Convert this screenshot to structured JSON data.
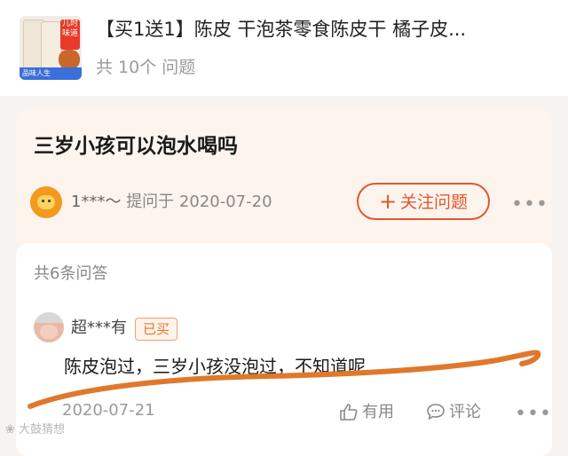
{
  "product": {
    "title": "【买1送1】陈皮 干泡茶零食陈皮干 橘子皮...",
    "question_count": "共 10个 问题",
    "thumb_tag": "儿时味道",
    "thumb_band": "品味人生"
  },
  "question": {
    "title": "三岁小孩可以泡水喝吗",
    "asker": "1***～",
    "asked_label": "提问于 2020-07-20",
    "follow_label": "关注问题",
    "more": "•••"
  },
  "answers": {
    "count_label": "共6条问答",
    "items": [
      {
        "user": "超***有",
        "badge": "已买",
        "text": "陈皮泡过，三岁小孩没泡过，不知道呢",
        "date": "2020-07-21",
        "useful_label": "有用",
        "comment_label": "评论",
        "more": "•••"
      }
    ]
  },
  "watermark": "大鼓猜想",
  "colors": {
    "accent": "#e2572e",
    "scribble": "#e0782c",
    "question_bg": "#fdf4ee"
  }
}
